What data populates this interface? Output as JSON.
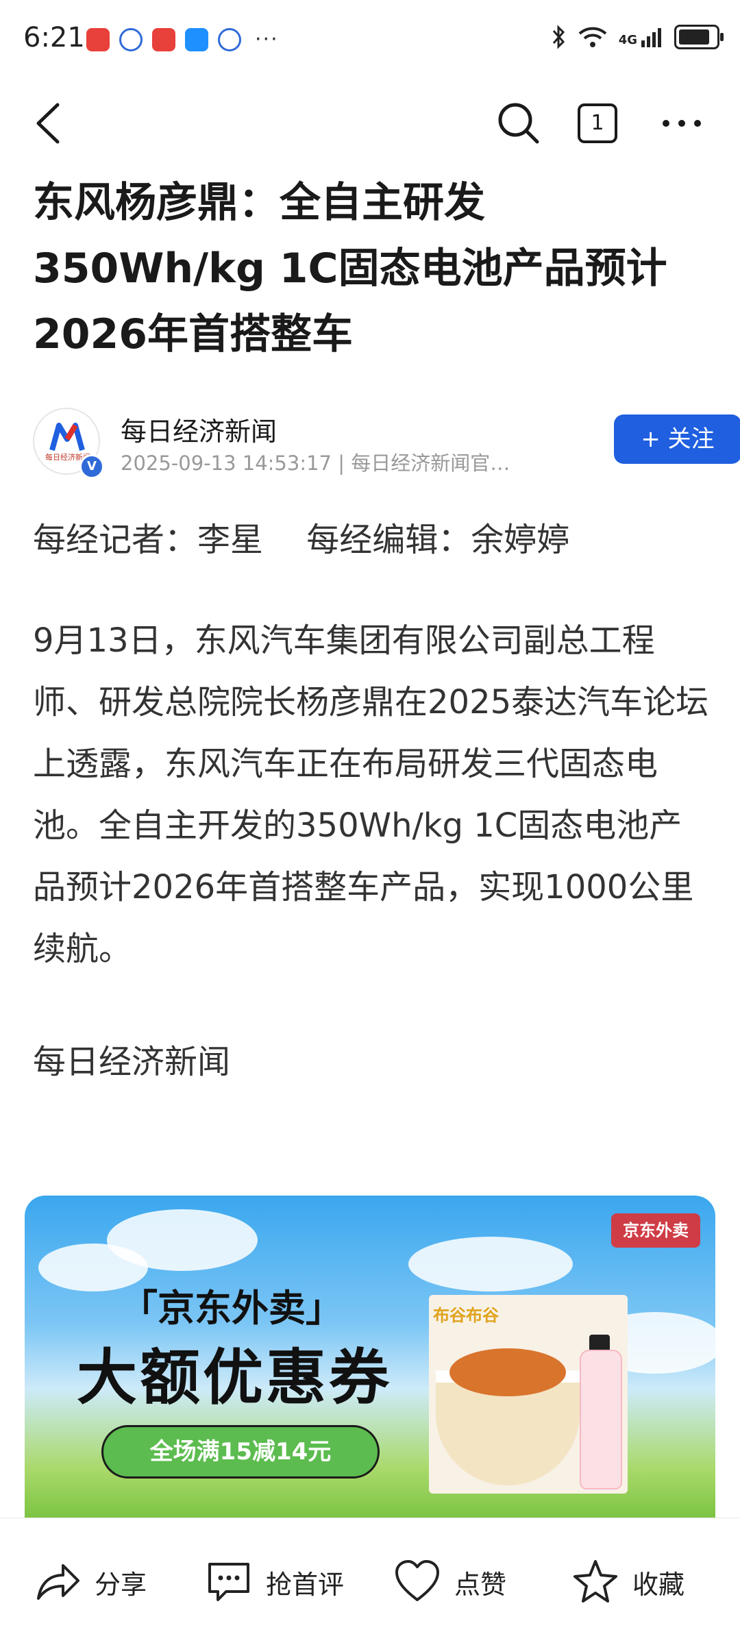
{
  "status_bar": {
    "time": "6:21",
    "notifications": [
      "huawei-icon",
      "baidu-icon",
      "huawei-icon",
      "weather-icon",
      "baidu-icon"
    ],
    "more": "···",
    "network": "4G"
  },
  "nav": {
    "tab_count": "1",
    "icons": [
      "back-icon",
      "search-icon",
      "tabs-icon",
      "more-icon"
    ]
  },
  "article": {
    "title": "东风杨彦鼎：全自主研发350Wh/kg 1C固态电池产品预计2026年首搭整车",
    "author": "每日经济新闻",
    "avatar_text": "每日经济新闻",
    "meta": "2025-09-13 14:53:17 | 每日经济新闻官…",
    "follow_label": "+ 关注",
    "reporter": "每经记者：李星　 每经编辑：余婷婷",
    "body": "9月13日，东风汽车集团有限公司副总工程师、研发总院院长杨彦鼎在2025泰达汽车论坛上透露，东风汽车正在布局研发三代固态电池。全自主开发的350Wh/kg 1C固态电池产品预计2026年首搭整车产品，实现1000公里续航。",
    "source": "每日经济新闻"
  },
  "ad": {
    "title_small": "「京东外卖」",
    "title_big": "大额优惠券",
    "pill": "全场满15减14元",
    "brand": "京东外卖",
    "product_label": "布谷布谷",
    "colors": {
      "pill": "#5cbc4f",
      "brand": "#e62828"
    }
  },
  "bottom_bar": {
    "share": "分享",
    "comment": "抢首评",
    "like": "点赞",
    "favorite": "收藏"
  },
  "colors": {
    "accent": "#1f5fe0",
    "text": "#1a1a1a",
    "meta": "#999999"
  }
}
